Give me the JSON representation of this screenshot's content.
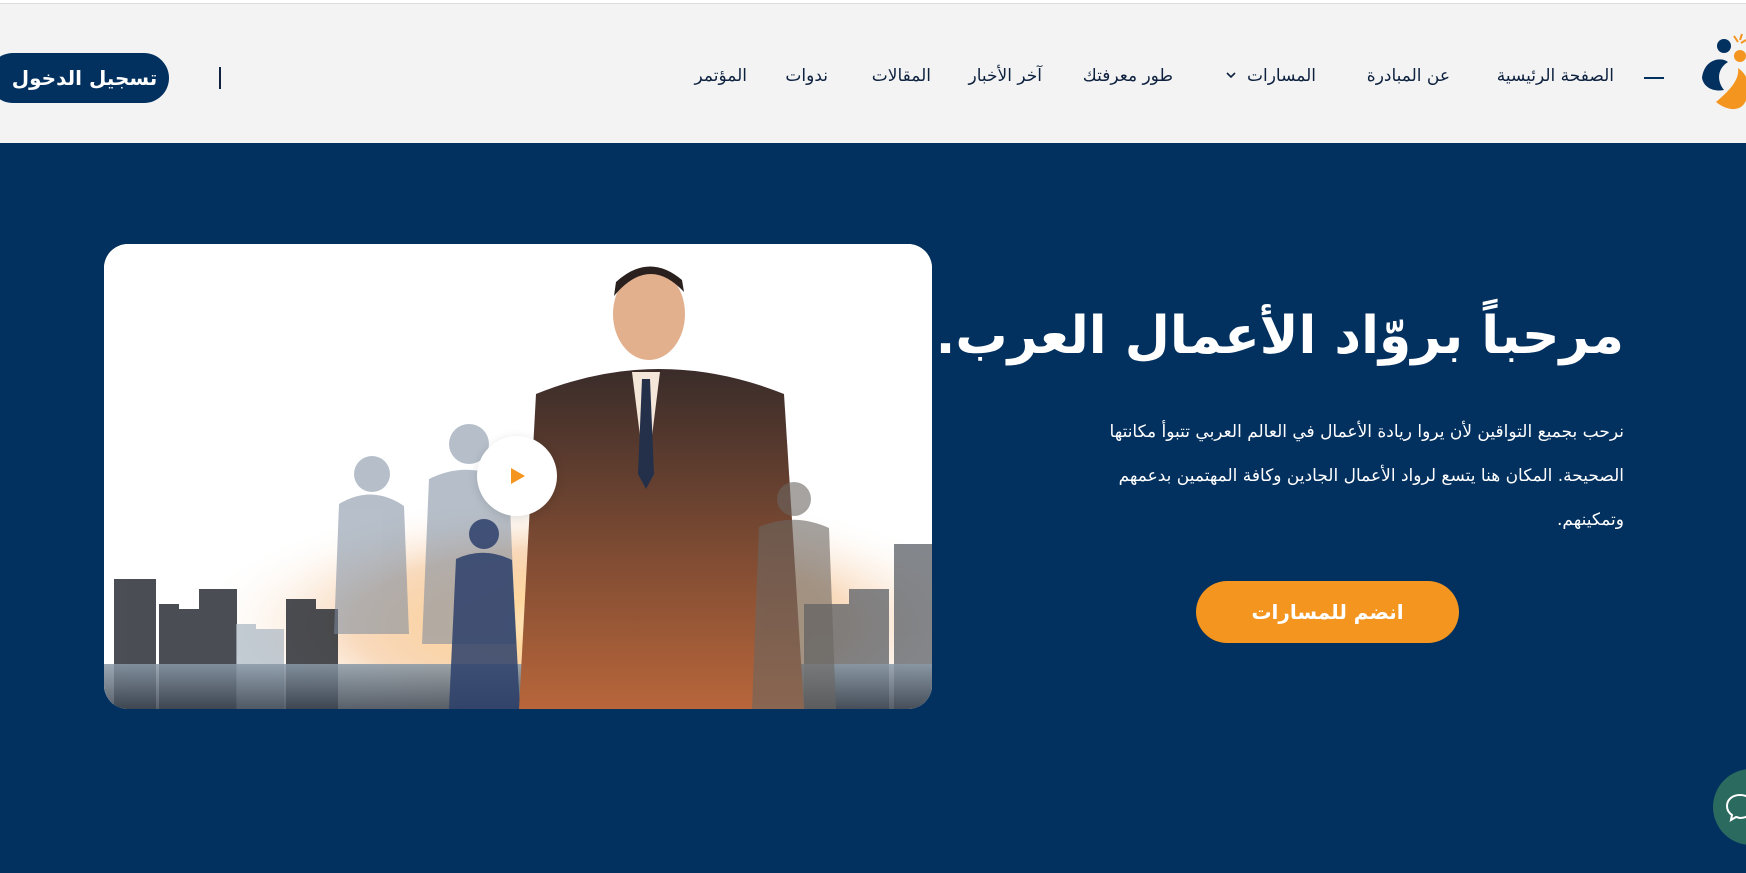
{
  "colors": {
    "brand_navy": "#02305f",
    "accent_orange": "#f3951f",
    "header_bg": "#f3f3f3",
    "text_dark": "#0e2240"
  },
  "header": {
    "logo_icon": "people-logo-icon",
    "nav": [
      {
        "label": "الصفحة الرئيسية"
      },
      {
        "label": "عن المبادرة"
      },
      {
        "label": "المسارات",
        "has_dropdown": true
      },
      {
        "label": "طور معرفتك"
      },
      {
        "label": "آخر الأخبار"
      },
      {
        "label": "المقالات"
      },
      {
        "label": "ندوات"
      },
      {
        "label": "المؤتمر"
      }
    ],
    "login_label": "تسجيل الدخول"
  },
  "hero": {
    "title": "مرحباً بروّاد الأعمال العرب.",
    "description_lines": [
      "نرحب بجميع التواقين لأن يروا ريادة الأعمال في العالم العربي تتبوأ مكانتها",
      "الصحيحة. المكان هنا يتسع لرواد الأعمال الجادين وكافة المهتمين بدعمهم",
      "وتمكينهم."
    ],
    "cta_label": "انضم للمسارات",
    "media": {
      "image_icon": "business-team-city-image",
      "play_icon": "play-icon"
    }
  },
  "floating": {
    "chat_icon": "chat-icon"
  }
}
